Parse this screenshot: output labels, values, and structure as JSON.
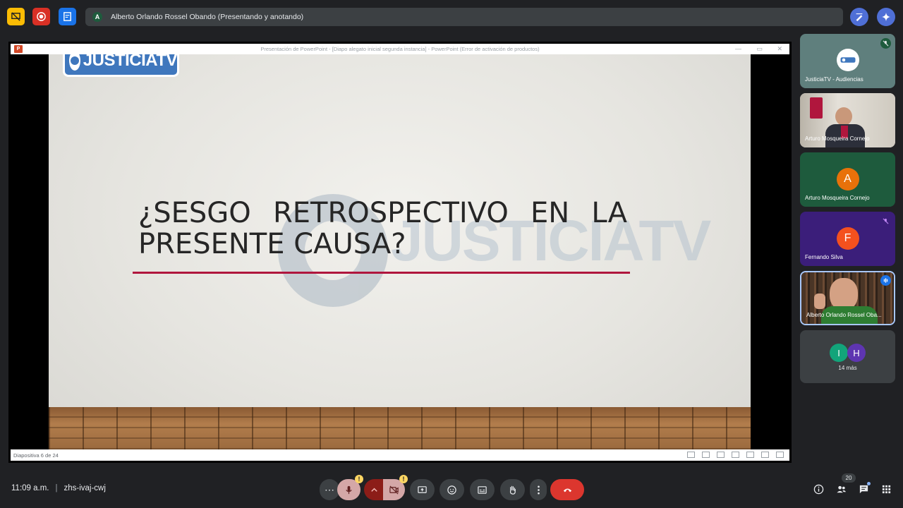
{
  "topbar": {
    "presenter_initial": "A",
    "presenter_label": "Alberto Orlando Rossel Obando (Presentando y anotando)",
    "icons": [
      "presentation-off-icon",
      "record-icon",
      "notes-icon",
      "annotate-icon",
      "gemini-icon"
    ]
  },
  "powerpoint": {
    "window_title": "Presentación de PowerPoint - [Diapo alegato inicial segunda instancia] - PowerPoint (Error de activación de productos)",
    "status_text": "Diapositiva 6 de 24",
    "window_controls": [
      "—",
      "▭",
      "✕"
    ]
  },
  "slide": {
    "logo_text": "JUSTICIATV",
    "watermark_text": "JUSTICIATV",
    "heading_line1_words": [
      "¿SESGO",
      "RETROSPECTIVO",
      "EN",
      "LA"
    ],
    "heading_line2": "PRESENTE CAUSA?",
    "accent_color": "#b0163d"
  },
  "participants": [
    {
      "name": "JusticiaTV - Audiencias",
      "type": "logo",
      "muted": true
    },
    {
      "name": "Arturo Mosqueira Cornejo",
      "type": "video",
      "muted": false
    },
    {
      "name": "Arturo Mosqueira Cornejo",
      "type": "avatar",
      "initial": "A",
      "color": "#e8710a",
      "muted": false
    },
    {
      "name": "Fernando Silva",
      "type": "avatar",
      "initial": "F",
      "color": "#f4511e",
      "muted": true
    },
    {
      "name": "Alberto Orlando Rossel Oba...",
      "type": "video",
      "speaking": true
    }
  ],
  "more_tile": {
    "initials": [
      "I",
      "H"
    ],
    "colors": [
      "#12a47a",
      "#5e35b1"
    ],
    "label": "14 más"
  },
  "bottombar": {
    "time": "11:09 a.m.",
    "separator": "|",
    "meeting_code": "zhs-ivaj-cwj",
    "participant_count": "20",
    "warning_glyph": "!",
    "more_glyph": "⋯"
  }
}
